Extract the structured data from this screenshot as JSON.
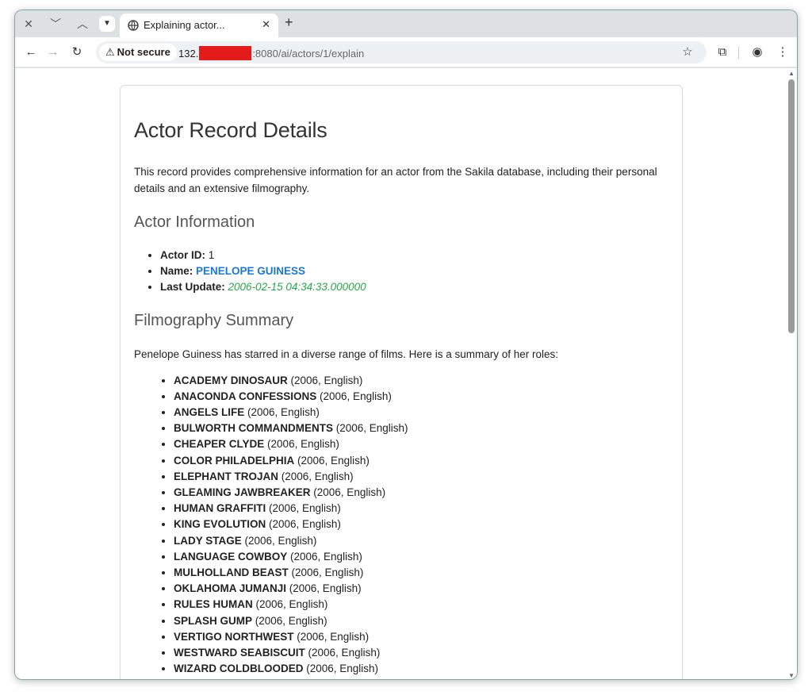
{
  "browser": {
    "tab_title": "Explaining actor...",
    "security_label": "Not secure",
    "url_prefix": "132.",
    "url_suffix": ":8080/ai/actors/1/explain"
  },
  "page": {
    "title": "Actor Record Details",
    "intro": "This record provides comprehensive information for an actor from the Sakila database, including their personal details and an extensive filmography.",
    "actor_section_title": "Actor Information",
    "actor_info": {
      "id_label": "Actor ID:",
      "id_value": "1",
      "name_label": "Name:",
      "name_value": "PENELOPE GUINESS",
      "update_label": "Last Update:",
      "update_value": "2006-02-15 04:34:33.000000"
    },
    "filmography_title": "Filmography Summary",
    "filmography_intro": "Penelope Guiness has starred in a diverse range of films. Here is a summary of her roles:",
    "films": [
      {
        "title": "ACADEMY DINOSAUR",
        "detail": "(2006, English)"
      },
      {
        "title": "ANACONDA CONFESSIONS",
        "detail": "(2006, English)"
      },
      {
        "title": "ANGELS LIFE",
        "detail": "(2006, English)"
      },
      {
        "title": "BULWORTH COMMANDMENTS",
        "detail": "(2006, English)"
      },
      {
        "title": "CHEAPER CLYDE",
        "detail": "(2006, English)"
      },
      {
        "title": "COLOR PHILADELPHIA",
        "detail": "(2006, English)"
      },
      {
        "title": "ELEPHANT TROJAN",
        "detail": "(2006, English)"
      },
      {
        "title": "GLEAMING JAWBREAKER",
        "detail": "(2006, English)"
      },
      {
        "title": "HUMAN GRAFFITI",
        "detail": "(2006, English)"
      },
      {
        "title": "KING EVOLUTION",
        "detail": "(2006, English)"
      },
      {
        "title": "LADY STAGE",
        "detail": "(2006, English)"
      },
      {
        "title": "LANGUAGE COWBOY",
        "detail": "(2006, English)"
      },
      {
        "title": "MULHOLLAND BEAST",
        "detail": "(2006, English)"
      },
      {
        "title": "OKLAHOMA JUMANJI",
        "detail": "(2006, English)"
      },
      {
        "title": "RULES HUMAN",
        "detail": "(2006, English)"
      },
      {
        "title": "SPLASH GUMP",
        "detail": "(2006, English)"
      },
      {
        "title": "VERTIGO NORTHWEST",
        "detail": "(2006, English)"
      },
      {
        "title": "WESTWARD SEABISCUIT",
        "detail": "(2006, English)"
      },
      {
        "title": "WIZARD COLDBLOODED",
        "detail": "(2006, English)"
      }
    ]
  },
  "colors": {
    "name_link": "#1a78d6",
    "date_value": "#28a745",
    "redaction": "#e51a1a"
  }
}
